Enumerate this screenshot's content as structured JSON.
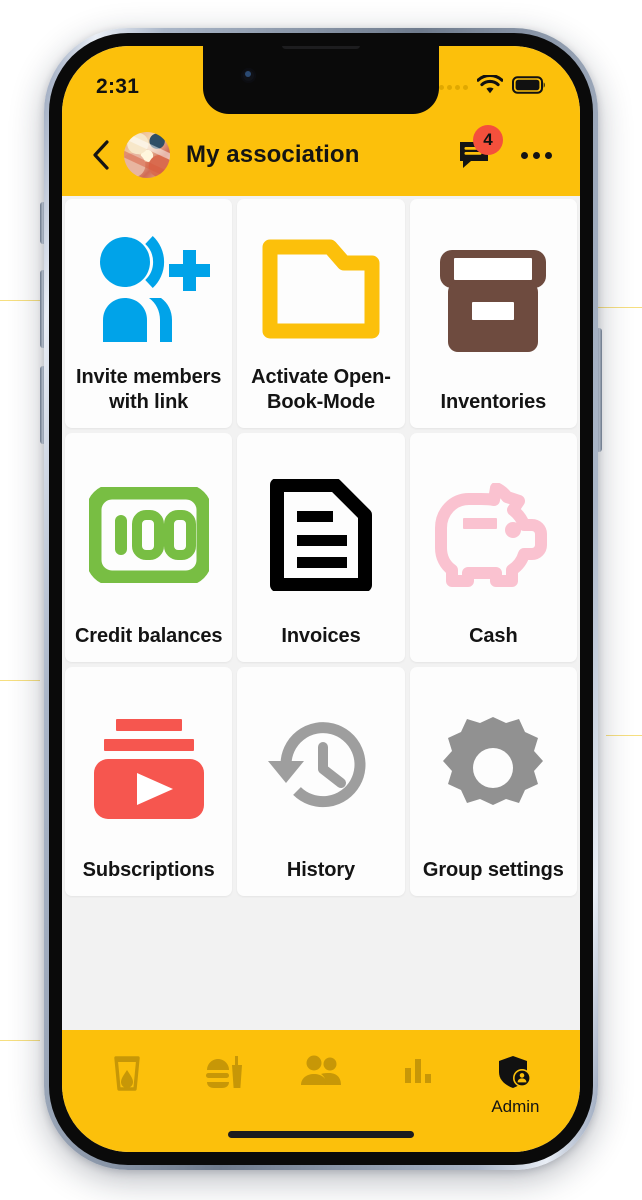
{
  "status_bar": {
    "time": "2:31",
    "cellular_icon": "cellular-dots-icon",
    "wifi_icon": "wifi-icon",
    "battery_icon": "battery-full-icon"
  },
  "app_bar": {
    "back_icon": "back-chevron-icon",
    "avatar_icon": "group-avatar-photo",
    "title": "My association",
    "chat_icon": "chat-bubble-icon",
    "chat_badge_count": "4",
    "menu_icon": "kebab-menu-icon",
    "background_color": "#FCC00B"
  },
  "grid": {
    "tiles": [
      {
        "id": "invite-members-with-link",
        "label": "Invite members with link",
        "icon": "person-add-icon",
        "color": "#00A3E9"
      },
      {
        "id": "activate-open-book-mode",
        "label": "Activate Open-Book-Mode",
        "icon": "open-folder-icon",
        "color": "#FCC00B"
      },
      {
        "id": "inventories",
        "label": "Inventories",
        "icon": "archive-box-icon",
        "color": "#6E4B3F"
      },
      {
        "id": "credit-balances",
        "label": "Credit balances",
        "icon": "banknote-100-icon",
        "color": "#78BE43"
      },
      {
        "id": "invoices",
        "label": "Invoices",
        "icon": "document-lines-icon",
        "color": "#000000"
      },
      {
        "id": "cash",
        "label": "Cash",
        "icon": "piggy-bank-icon",
        "color": "#FAC2D0"
      },
      {
        "id": "subscriptions",
        "label": "Subscriptions",
        "icon": "subscriptions-play-icon",
        "color": "#F6564F"
      },
      {
        "id": "history",
        "label": "History",
        "icon": "history-clock-icon",
        "color": "#9E9E9E"
      },
      {
        "id": "group-settings",
        "label": "Group settings",
        "icon": "gear-icon",
        "color": "#919191"
      }
    ]
  },
  "bottom_nav": {
    "items": [
      {
        "id": "drinks",
        "icon": "drink-glass-icon",
        "label": ""
      },
      {
        "id": "food",
        "icon": "burger-drink-icon",
        "label": ""
      },
      {
        "id": "members",
        "icon": "people-icon",
        "label": ""
      },
      {
        "id": "stats",
        "icon": "bar-chart-icon",
        "label": ""
      },
      {
        "id": "admin",
        "icon": "shield-person-icon",
        "label": "Admin"
      }
    ],
    "active_item": "admin",
    "background_color": "#FCC00B"
  }
}
